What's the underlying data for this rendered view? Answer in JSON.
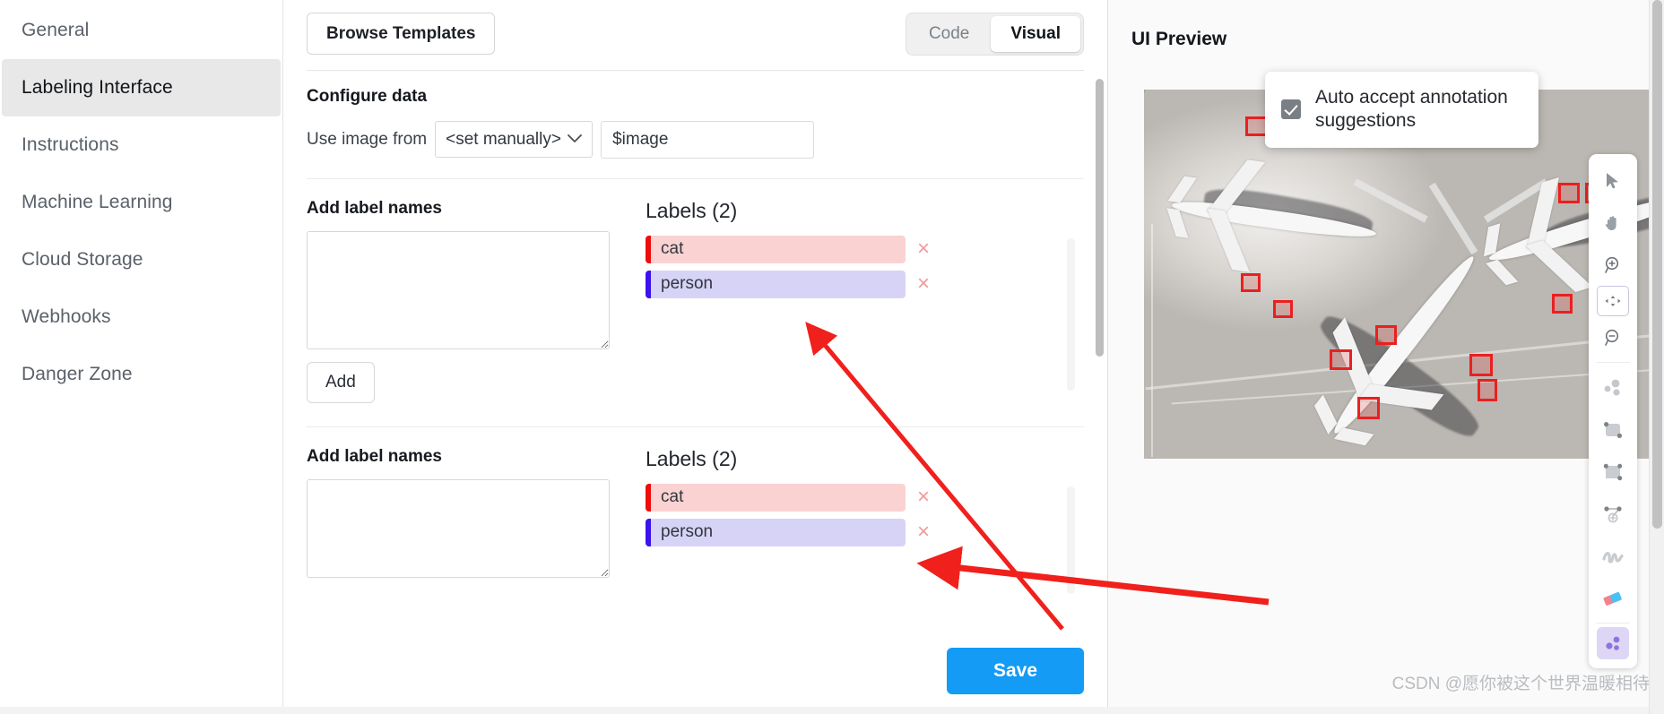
{
  "sidebar": {
    "items": [
      {
        "label": "General",
        "active": false
      },
      {
        "label": "Labeling Interface",
        "active": true
      },
      {
        "label": "Instructions",
        "active": false
      },
      {
        "label": "Machine Learning",
        "active": false
      },
      {
        "label": "Cloud Storage",
        "active": false
      },
      {
        "label": "Webhooks",
        "active": false
      },
      {
        "label": "Danger Zone",
        "active": false
      }
    ]
  },
  "toolbar": {
    "browse_templates_label": "Browse Templates",
    "mode_code_label": "Code",
    "mode_visual_label": "Visual",
    "active_mode": "Visual"
  },
  "configure": {
    "title": "Configure data",
    "use_image_from_label": "Use image from",
    "source_select_value": "<set manually>",
    "source_select_options": [
      "<set manually>"
    ],
    "variable_value": "$image",
    "variable_placeholder": "$image"
  },
  "label_sections": [
    {
      "add_label_title": "Add label names",
      "textarea_value": "",
      "textarea_placeholder": "",
      "add_button_label": "Add",
      "labels_heading": "Labels (2)",
      "labels": [
        {
          "name": "cat",
          "bar_color": "#ee0d0d",
          "fill_color": "#fad2d2",
          "remove_label": "×"
        },
        {
          "name": "person",
          "bar_color": "#3b13ee",
          "fill_color": "#d7d3f7",
          "remove_label": "×"
        }
      ]
    },
    {
      "add_label_title": "Add label names",
      "textarea_value": "",
      "textarea_placeholder": "",
      "labels_heading": "Labels (2)",
      "labels": [
        {
          "name": "cat",
          "bar_color": "#ee0d0d",
          "fill_color": "#fad2d2",
          "remove_label": "×"
        },
        {
          "name": "person",
          "bar_color": "#3b13ee",
          "fill_color": "#d7d3f7",
          "remove_label": "×"
        }
      ]
    }
  ],
  "footer": {
    "save_label": "Save",
    "save_color": "#139bf5"
  },
  "preview": {
    "title": "UI Preview",
    "tooltip_text": "Auto accept annotation suggestions",
    "tooltip_checked": true,
    "image_description": "Aerial photo of airport apron with parked airliners and red annotation boxes"
  },
  "tools": [
    {
      "name": "cursor-icon",
      "title": "Select"
    },
    {
      "name": "hand-icon",
      "title": "Pan"
    },
    {
      "name": "zoom-in-icon",
      "title": "Zoom in"
    },
    {
      "name": "fit-to-screen-icon",
      "title": "Fit to screen"
    },
    {
      "name": "zoom-out-icon",
      "title": "Zoom out"
    },
    {
      "name": "keypoints-icon",
      "title": "Keypoints"
    },
    {
      "name": "rectangle-icon",
      "title": "Rectangle"
    },
    {
      "name": "polygon-icon",
      "title": "Polygon"
    },
    {
      "name": "add-point-icon",
      "title": "Add point"
    },
    {
      "name": "brush-icon",
      "title": "Brush"
    },
    {
      "name": "eraser-icon",
      "title": "Eraser"
    },
    {
      "name": "magic-wand-icon",
      "title": "Magic wand"
    }
  ],
  "watermark": "CSDN @愿你被这个世界温暖相待"
}
